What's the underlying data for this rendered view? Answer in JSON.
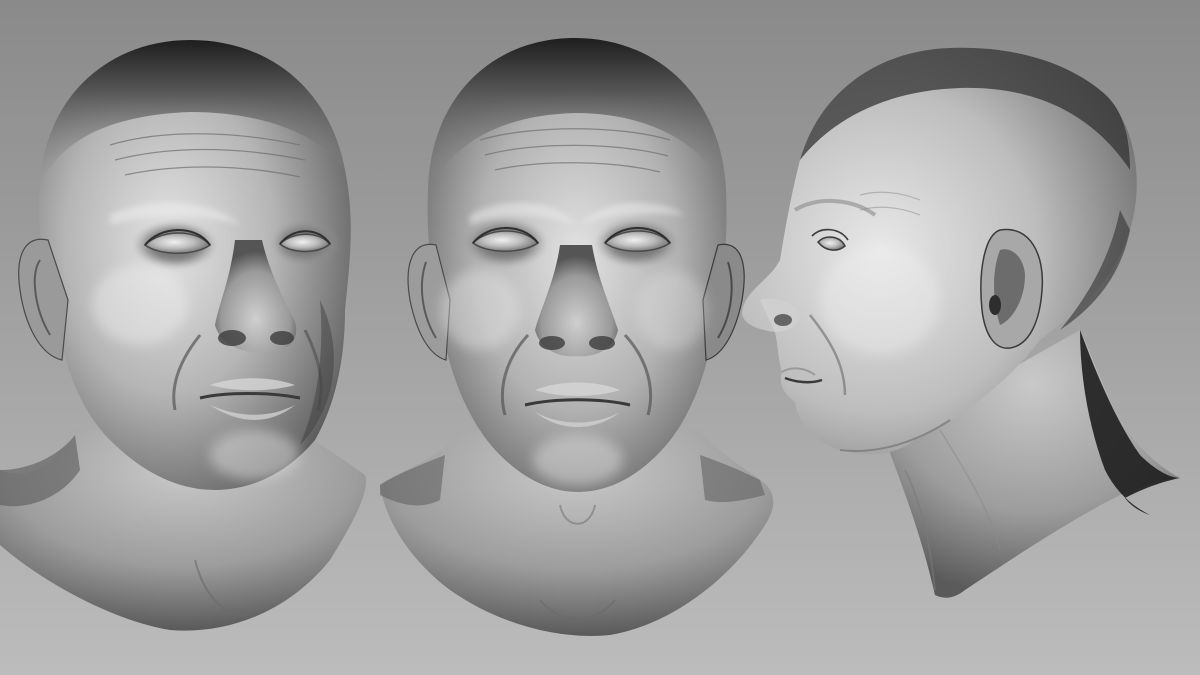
{
  "scene": {
    "description_visible_text": "",
    "views": [
      {
        "id": "front-three-quarter",
        "icon": "sculpt-head-icon"
      },
      {
        "id": "front",
        "icon": "sculpt-head-icon"
      },
      {
        "id": "profile-left",
        "icon": "sculpt-head-icon"
      }
    ]
  },
  "colors": {
    "background_top": "#8c8c8c",
    "background_bottom": "#b8b8b8",
    "skin_highlight": "#e6e6e6",
    "skin_mid": "#a6a6a6",
    "skin_shadow": "#3c3c3c",
    "skin_dark": "#1f1f1f"
  }
}
